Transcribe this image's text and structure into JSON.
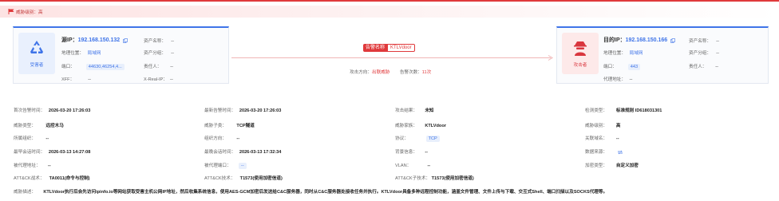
{
  "threat_level": {
    "label": "威胁级别：高",
    "color": "#e0393b"
  },
  "source": {
    "role": "受害者",
    "ip_label": "源IP：",
    "ip": "192.168.150.132",
    "geo_label": "地理位置：",
    "geo": "局域网",
    "port_label": "端口：",
    "port": "44630,46254,4...",
    "xff_label": "XFF：",
    "xff": "--",
    "asset_name_label": "资产名称：",
    "asset_name": "--",
    "asset_group_label": "资产分组：",
    "asset_group": "--",
    "owner_label": "责任人：",
    "owner": "--",
    "xrealip_label": "X-Real-IP：",
    "xrealip": "--"
  },
  "target": {
    "role": "攻击者",
    "ip_label": "目的IP：",
    "ip": "192.168.150.166",
    "geo_label": "地理位置：",
    "geo": "局域网",
    "port_label": "端口：",
    "port": "443",
    "proxy_label": "代理地址：",
    "proxy": "--",
    "asset_name_label": "资产名称：",
    "asset_name": "--",
    "asset_group_label": "资产分组：",
    "asset_group": "--",
    "owner_label": "责任人：",
    "owner": "--"
  },
  "alarm": {
    "name_label": "告警名称",
    "name": "KTLVdoor",
    "direction_label": "攻击方向：",
    "direction": "出联威胁",
    "count_label": "告警次数：",
    "count": "11次"
  },
  "details": {
    "row1": [
      {
        "k": "首次告警时间：",
        "v": "2026-03-20 17:26:03"
      },
      {
        "k": "最新告警时间：",
        "v": "2026-03-20 17:26:03"
      },
      {
        "k": "攻击结果：",
        "v": "未知"
      },
      {
        "k": "检测类型：",
        "v": "标准规则 ID618031301"
      }
    ],
    "row2": [
      {
        "k": "威胁类型：",
        "v": "远控木马"
      },
      {
        "k": "威胁子类：",
        "v": "TCP隧道"
      },
      {
        "k": "威胁家族：",
        "v": "KTLVdoor"
      },
      {
        "k": "威胁级别：",
        "v": "高"
      }
    ],
    "row3": [
      {
        "k": "所属组织：",
        "v": "--"
      },
      {
        "k": "组织方向：",
        "v": "--"
      },
      {
        "k": "协议：",
        "v": "TCP"
      },
      {
        "k": "关联域名：",
        "v": "--"
      }
    ],
    "row4": [
      {
        "k": "最早会话时间：",
        "v": "2026-03-13 14:27:08"
      },
      {
        "k": "最晚会话时间：",
        "v": "2026-03-13 17:32:34"
      },
      {
        "k": "背景信息：",
        "v": "--"
      },
      {
        "k": "数据来源：",
        "v": ""
      }
    ],
    "row5": [
      {
        "k": "被代理地址：",
        "v": "--"
      },
      {
        "k": "被代理端口：",
        "v": "--"
      },
      {
        "k": "VLAN：",
        "v": "--"
      },
      {
        "k": "加密类型：",
        "v": "自定义加密"
      }
    ],
    "row6": [
      {
        "k": "ATT&CK战术：",
        "v": "TA0011(命令与控制)"
      },
      {
        "k": "ATT&CK技术：",
        "v": "T1573(使用加密信道)"
      },
      {
        "k": "ATT&CK子技术：",
        "v": "T1573(使用加密信道)"
      }
    ],
    "description_label": "威胁描述：",
    "description": "KTLVdoor执行后会先访问ipinfo.io等网站获取受害主机公网IP地址，然后收集系统信息，使用AES-GCM加密后发送给C&C服务器，同时从C&C服务器处接收任务并执行。KTLVdoor具备多种远程控制功能，涵盖文件管理、文件上传与下载、交互式Shell、端口扫描以及SOCKS代理等。"
  }
}
